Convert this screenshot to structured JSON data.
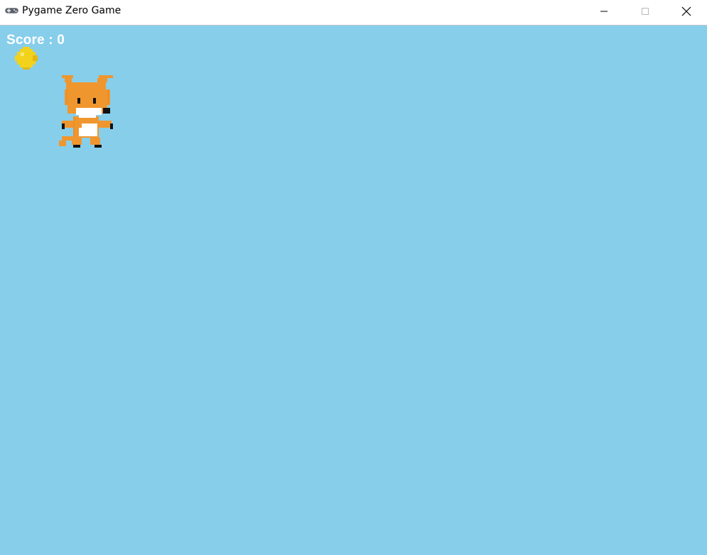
{
  "window": {
    "title": "Pygame Zero Game",
    "app_icon": "gamepad-icon",
    "controls": {
      "minimize_icon": "minimize-icon",
      "maximize_icon": "maximize-icon",
      "close_icon": "close-icon"
    }
  },
  "game": {
    "background_color": "#87ceeb",
    "score_text": "Score : 0",
    "sprites": {
      "coin": "coin-sprite",
      "player": "fox-sprite"
    },
    "colors": {
      "coin": "#f2d21b",
      "fox_orange": "#f0962e",
      "fox_white": "#ffffff",
      "fox_black": "#111111"
    }
  }
}
